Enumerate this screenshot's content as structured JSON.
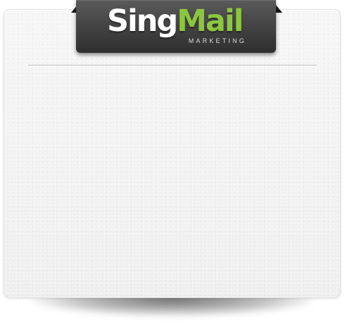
{
  "brand": {
    "name_part1": "Sing",
    "name_part2": "Mail",
    "tagline": "MARKETING",
    "colors": {
      "primary_text": "#ffffff",
      "accent": "#8cc63f",
      "tab_background": "#454545"
    }
  }
}
